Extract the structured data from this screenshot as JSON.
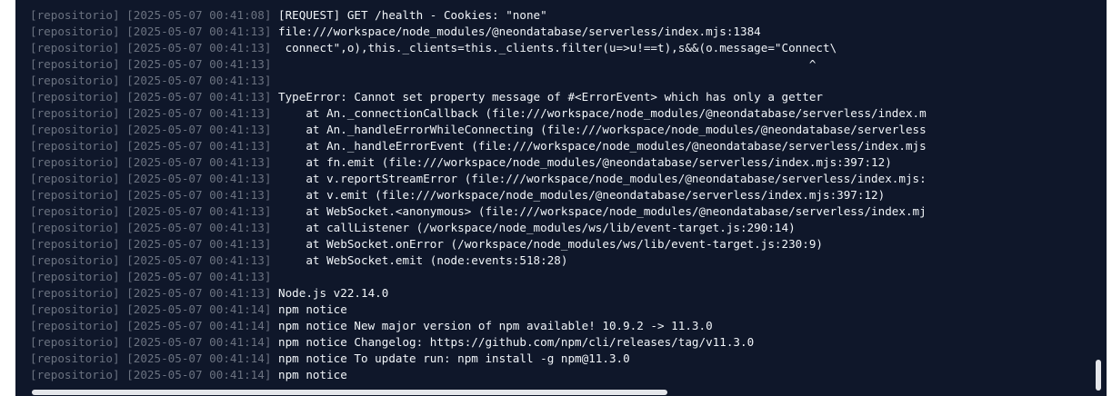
{
  "log": {
    "lines": [
      {
        "source": "[repositorio]",
        "timestamp": "[2025-05-07 00:41:08]",
        "message": "[REQUEST] GET /health - Cookies: \"none\""
      },
      {
        "source": "[repositorio]",
        "timestamp": "[2025-05-07 00:41:13]",
        "message": "file:///workspace/node_modules/@neondatabase/serverless/index.mjs:1384"
      },
      {
        "source": "[repositorio]",
        "timestamp": "[2025-05-07 00:41:13]",
        "message": " connect\",o),this._clients=this._clients.filter(u=>u!==t),s&&(o.message=\"Connect\\"
      },
      {
        "source": "[repositorio]",
        "timestamp": "[2025-05-07 00:41:13]",
        "message": "                                                                             ^"
      },
      {
        "source": "[repositorio]",
        "timestamp": "[2025-05-07 00:41:13]",
        "message": ""
      },
      {
        "source": "[repositorio]",
        "timestamp": "[2025-05-07 00:41:13]",
        "message": "TypeError: Cannot set property message of #<ErrorEvent> which has only a getter"
      },
      {
        "source": "[repositorio]",
        "timestamp": "[2025-05-07 00:41:13]",
        "message": "    at An._connectionCallback (file:///workspace/node_modules/@neondatabase/serverless/index.m"
      },
      {
        "source": "[repositorio]",
        "timestamp": "[2025-05-07 00:41:13]",
        "message": "    at An._handleErrorWhileConnecting (file:///workspace/node_modules/@neondatabase/serverless"
      },
      {
        "source": "[repositorio]",
        "timestamp": "[2025-05-07 00:41:13]",
        "message": "    at An._handleErrorEvent (file:///workspace/node_modules/@neondatabase/serverless/index.mjs"
      },
      {
        "source": "[repositorio]",
        "timestamp": "[2025-05-07 00:41:13]",
        "message": "    at fn.emit (file:///workspace/node_modules/@neondatabase/serverless/index.mjs:397:12)"
      },
      {
        "source": "[repositorio]",
        "timestamp": "[2025-05-07 00:41:13]",
        "message": "    at v.reportStreamError (file:///workspace/node_modules/@neondatabase/serverless/index.mjs:"
      },
      {
        "source": "[repositorio]",
        "timestamp": "[2025-05-07 00:41:13]",
        "message": "    at v.emit (file:///workspace/node_modules/@neondatabase/serverless/index.mjs:397:12)"
      },
      {
        "source": "[repositorio]",
        "timestamp": "[2025-05-07 00:41:13]",
        "message": "    at WebSocket.<anonymous> (file:///workspace/node_modules/@neondatabase/serverless/index.mj"
      },
      {
        "source": "[repositorio]",
        "timestamp": "[2025-05-07 00:41:13]",
        "message": "    at callListener (/workspace/node_modules/ws/lib/event-target.js:290:14)"
      },
      {
        "source": "[repositorio]",
        "timestamp": "[2025-05-07 00:41:13]",
        "message": "    at WebSocket.onError (/workspace/node_modules/ws/lib/event-target.js:230:9)"
      },
      {
        "source": "[repositorio]",
        "timestamp": "[2025-05-07 00:41:13]",
        "message": "    at WebSocket.emit (node:events:518:28)"
      },
      {
        "source": "[repositorio]",
        "timestamp": "[2025-05-07 00:41:13]",
        "message": ""
      },
      {
        "source": "[repositorio]",
        "timestamp": "[2025-05-07 00:41:13]",
        "message": "Node.js v22.14.0"
      },
      {
        "source": "[repositorio]",
        "timestamp": "[2025-05-07 00:41:14]",
        "message": "npm notice"
      },
      {
        "source": "[repositorio]",
        "timestamp": "[2025-05-07 00:41:14]",
        "message": "npm notice New major version of npm available! 10.9.2 -> 11.3.0"
      },
      {
        "source": "[repositorio]",
        "timestamp": "[2025-05-07 00:41:14]",
        "message": "npm notice Changelog: https://github.com/npm/cli/releases/tag/v11.3.0"
      },
      {
        "source": "[repositorio]",
        "timestamp": "[2025-05-07 00:41:14]",
        "message": "npm notice To update run: npm install -g npm@11.3.0"
      },
      {
        "source": "[repositorio]",
        "timestamp": "[2025-05-07 00:41:14]",
        "message": "npm notice"
      }
    ]
  },
  "colors": {
    "background": "#0f172a",
    "prefix_text": "#6b7280",
    "message_text": "#f1f5f9",
    "scrollbar_thumb": "#e5e7eb"
  }
}
